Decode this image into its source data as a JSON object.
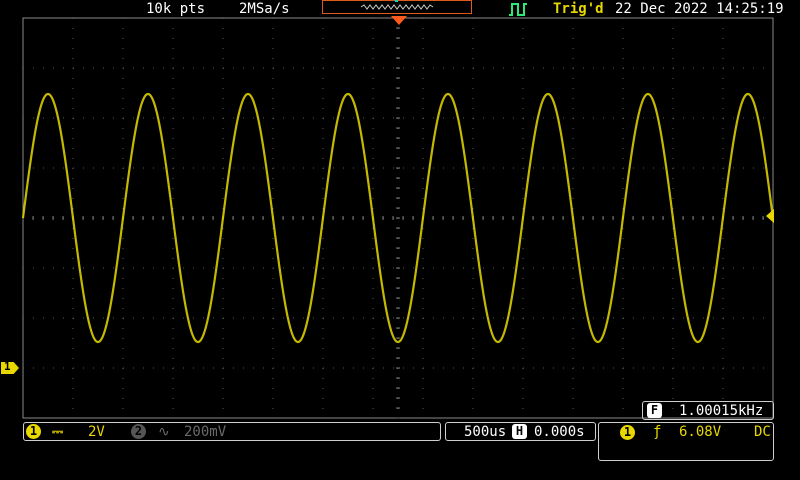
{
  "header": {
    "record_length": "10k pts",
    "sample_rate": "2MSa/s",
    "trigger_status": "Trig'd",
    "datetime": "22 Dec 2022 14:25:19"
  },
  "channel1": {
    "marker": "1",
    "coupling_symbol": "⎓",
    "volts_per_div": "2V"
  },
  "channel2": {
    "marker": "2",
    "coupling_symbol": "∿",
    "volts_per_div": "200mV"
  },
  "timebase": {
    "time_per_div": "500us",
    "marker": "H",
    "position": "0.000s"
  },
  "trigger": {
    "source": "1",
    "slope_symbol": "ƒ",
    "level": "6.08V",
    "coupling": "DC"
  },
  "frequency_counter": {
    "marker": "F",
    "value": "1.00015kHz"
  },
  "colors": {
    "ch1": "#e8d800",
    "trigger_marker": "#ff5a1e",
    "ch2": "#6a6a6a"
  },
  "waveform": {
    "type": "sine",
    "frequency_hz": 1000.15,
    "amplitude_divisions": 2.48,
    "offset_divisions": 0,
    "time_per_div_s": 0.0005,
    "horizontal_divisions": 15,
    "vertical_divisions": 8,
    "starting_phase": "rising"
  }
}
